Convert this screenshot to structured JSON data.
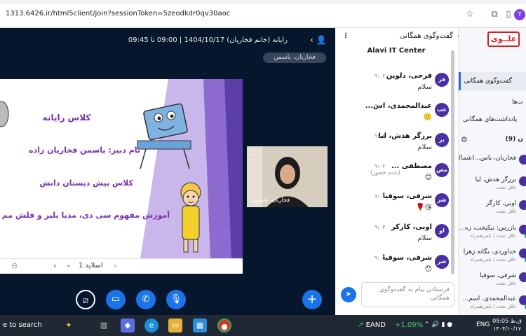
{
  "browser": {
    "url": "1313.6426.ir/html5client/join?sessionToken=5zeodkdr0qv30aoc",
    "profile_initial": "Y"
  },
  "meeting": {
    "title": "رایانه (خانم فخاریان) 1404/10/17 | 09:00 تا 09:45",
    "talking": "فخاریان، یاسمن"
  },
  "slide": {
    "line1": "کلاس رایانه",
    "line2": "نام دبیر: یاسمن فخاریان زاده",
    "line3": "کلاس پیش دبستان دانش",
    "line4": "آموزش مفهوم سی دی، مدیا پلیر و فلش مم",
    "page_label": "اسلاید 1"
  },
  "webcam": {
    "name": "فخاریان، یاسمن"
  },
  "chat": {
    "title": "گفت‌وگوی همگانی",
    "banner": "Alavi IT Center",
    "messages": [
      {
        "initials": "فر",
        "name": "فرحی، دلوین",
        "time": "۹:۰۲",
        "text": "سلام"
      },
      {
        "initials": "عب",
        "name": "عبدالمحمدی، اس...",
        "time": "۹:۰۲",
        "text": "🙂"
      },
      {
        "initials": "بر",
        "name": "برزگر هدش، لیا",
        "time": "۹:۰۲",
        "text": "سلام"
      },
      {
        "initials": "مص",
        "name": "مصطفی ...",
        "time": "۹:۰۲",
        "text": "😊",
        "status": "(عدم حضور)"
      },
      {
        "initials": "شر",
        "name": "شرفی، سوفیا",
        "time": "۹:۰۴",
        "text": "🌹😘"
      },
      {
        "initials": "او",
        "name": "اوبی، کارکر",
        "time": "۹:۰۴",
        "text": "سلام"
      },
      {
        "initials": "شر",
        "name": "شرفی، سوفیا",
        "time": "۹:۰۵",
        "text": "😯"
      }
    ],
    "input_placeholder": "فرستادن پیام به گفت‌وگوی همگانی"
  },
  "nav": {
    "logo_text": "علــوی",
    "active": "گفت‌وگوی همگانی",
    "items": [
      "ت‌ها",
      "یادداشت‌های همگانی"
    ],
    "users_header": "ن (9)",
    "users": [
      {
        "name": "فخاریان، یاس...(شما)",
        "sub": ""
      },
      {
        "name": "برزگر هدش، لیا",
        "sub": "ناقل شده"
      },
      {
        "name": "اوبی، کارگر",
        "sub": "ناقل شده"
      },
      {
        "name": "بازرس: نیکبخت، زه...",
        "sub": "ناقل شده | تلفن‌همراه"
      },
      {
        "name": "خداوردی، یگانه زهرا",
        "sub": "ناقل شده | تلفن‌همراه"
      },
      {
        "name": "شرفی، سوفیا",
        "sub": "ناقل شده"
      },
      {
        "name": "عبدالمحمدی، اسم...",
        "sub": "ناقل شده | تلفن‌همراه"
      }
    ]
  },
  "taskbar": {
    "search_label": "e to search",
    "stock_name": "EAND",
    "stock_change": "+1.09%",
    "lang": "ENG",
    "time": "09:05",
    "ampm": "ق.ظ",
    "date": "۱۴۰۴/۱۰/۱۷"
  }
}
